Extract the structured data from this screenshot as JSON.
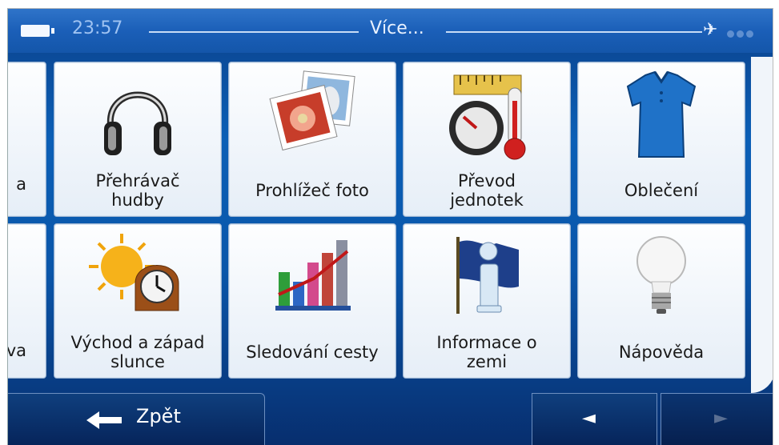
{
  "status_bar": {
    "time": "23:57",
    "title": "Více...",
    "battery_icon": "battery-icon",
    "gps_icon": "satellite-icon"
  },
  "tiles": [
    {
      "label": "a",
      "icon": "partial-tile"
    },
    {
      "label": "Přehrávač\nhudby",
      "icon": "headphones-icon"
    },
    {
      "label": "Prohlížeč foto",
      "icon": "photos-icon"
    },
    {
      "label": "Převod\njednotek",
      "icon": "ruler-gauge-thermometer-icon"
    },
    {
      "label": "Oblečení",
      "icon": "shirt-icon"
    },
    {
      "label": "va",
      "icon": "partial-tile"
    },
    {
      "label": "Východ a západ\nslunce",
      "icon": "sun-clock-icon"
    },
    {
      "label": "Sledování cesty",
      "icon": "bar-chart-icon"
    },
    {
      "label": "Informace o\nzemi",
      "icon": "info-flag-icon"
    },
    {
      "label": "Nápověda",
      "icon": "lightbulb-icon"
    }
  ],
  "bottom_bar": {
    "back_label": "Zpět",
    "prev_glyph": "◄",
    "next_glyph": "►"
  },
  "colors": {
    "background": "#0b5fb6",
    "tile": "#f3f7fb",
    "text": "#1a1a1a"
  }
}
